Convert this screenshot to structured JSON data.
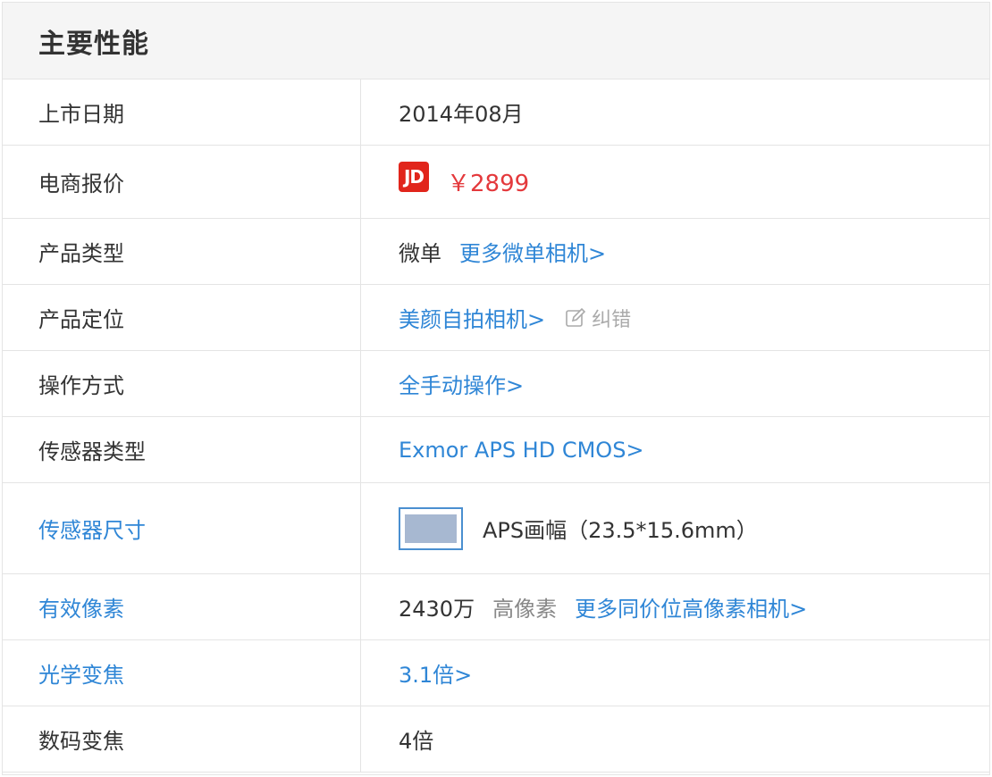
{
  "section": {
    "title": "主要性能"
  },
  "rows": {
    "release": {
      "label": "上市日期",
      "value": "2014年08月"
    },
    "price": {
      "label": "电商报价",
      "logo": "JD",
      "value": "￥2899"
    },
    "type": {
      "label": "产品类型",
      "value": "微单",
      "link": "更多微单相机>"
    },
    "position": {
      "label": "产品定位",
      "link": "美颜自拍相机>",
      "correct": "纠错"
    },
    "operation": {
      "label": "操作方式",
      "link": "全手动操作>"
    },
    "sensor_type": {
      "label": "传感器类型",
      "link": "Exmor APS HD CMOS>"
    },
    "sensor_size": {
      "label": "传感器尺寸",
      "value": "APS画幅（23.5*15.6mm）"
    },
    "pixels": {
      "label": "有效像素",
      "value": "2430万",
      "tag": "高像素",
      "link": "更多同价位高像素相机>"
    },
    "optical_zoom": {
      "label": "光学变焦",
      "link": "3.1倍>"
    },
    "digital_zoom": {
      "label": "数码变焦",
      "value": "4倍"
    }
  },
  "colors": {
    "link": "#2f86d6",
    "price": "#e4393c",
    "jd_brand": "#e1251b",
    "border": "#e4e4e4",
    "header_bg": "#f5f5f5"
  },
  "icons": {
    "correct": "pencil-icon",
    "sensor": "sensor-size-icon"
  }
}
